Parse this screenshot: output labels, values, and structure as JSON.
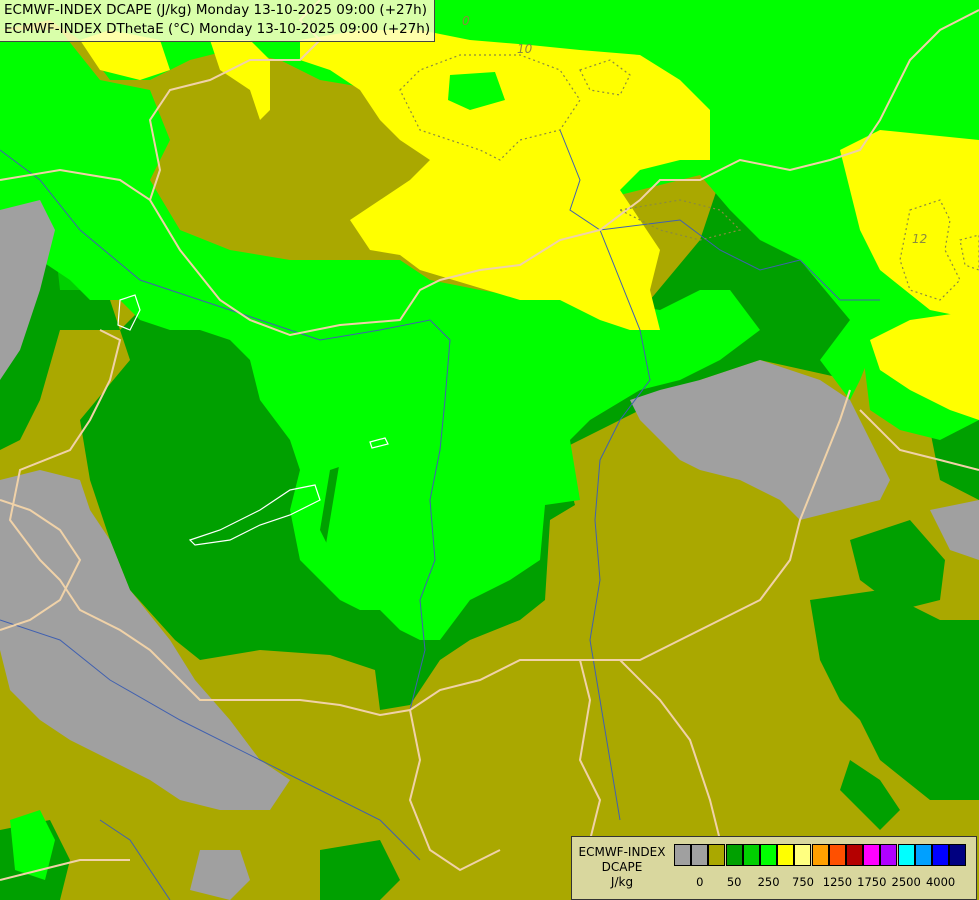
{
  "title_lines": [
    "ECMWF-INDEX DCAPE (J/kg) Monday 13-10-2025 09:00 (+27h)",
    "ECMWF-INDEX DThetaE (°C) Monday 13-10-2025 09:00 (+27h)"
  ],
  "legend": {
    "title_line1": "ECMWF-INDEX",
    "title_line2": "DCAPE",
    "unit": "J/kg",
    "colors": [
      "#a0a0a0",
      "#a0a0a0",
      "#aaa800",
      "#00a000",
      "#00d000",
      "#00ff00",
      "#ffff00",
      "#ffff80",
      "#ffa000",
      "#ff5000",
      "#b40000",
      "#ff00ff",
      "#b000ff",
      "#00ffff",
      "#00a0ff",
      "#0000ff",
      "#000080"
    ],
    "tick_labels": [
      "0",
      "50",
      "250",
      "750",
      "1250",
      "1750",
      "2500",
      "4000"
    ]
  },
  "contour_labels": [
    "10",
    "12",
    "0"
  ],
  "colors": {
    "none": "#a0a0a0",
    "olive": "#aaa800",
    "dark_green": "#00a000",
    "mid_green": "#00d000",
    "light_green": "#00ff00",
    "yellow": "#ffff00",
    "border": "#e8c8a0",
    "river": "#4060b0"
  }
}
